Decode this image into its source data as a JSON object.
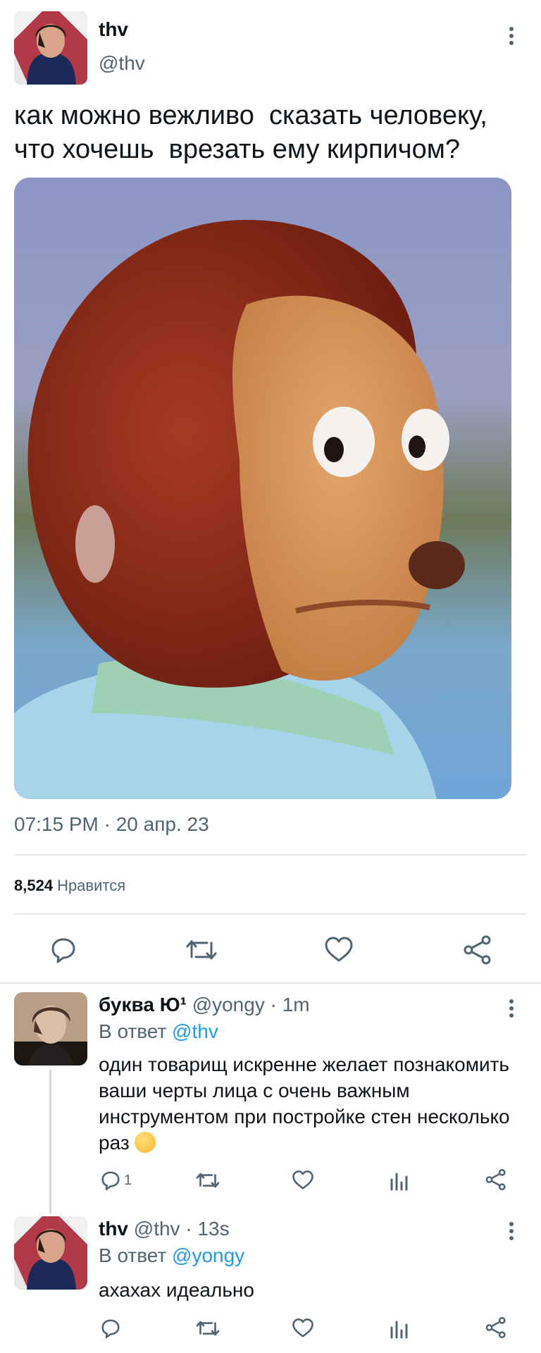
{
  "tweet": {
    "author_name": "thv",
    "author_handle": "@thv",
    "text": "как можно вежливо  сказать человеку,\nчто хочешь  врезать ему кирпичом?",
    "timestamp": "07:15 PM · 20 апр. 23",
    "likes_count": "8,524",
    "likes_label": "Нравится",
    "actions": [
      "reply-icon",
      "retweet-icon",
      "like-icon",
      "share-icon"
    ]
  },
  "replies": [
    {
      "name": "буква Ю¹",
      "meta": "@yongy · 1m",
      "reply_prefix": "В ответ",
      "reply_to": "@thv",
      "text": "один товарищ  искренне желает познакомить ваши черты лица с очень важным инструментом при постройке стен несколько раз",
      "reply_count": "1",
      "emoji": "smirking-hand-over-mouth-emoji"
    },
    {
      "name": "thv",
      "meta": "@thv · 13s",
      "reply_prefix": "В ответ",
      "reply_to": "@yongy",
      "text": "ахахах идеально",
      "reply_count": ""
    }
  ],
  "colors": {
    "accent": "#1d9bf0",
    "secondary_text": "#536471",
    "primary_text": "#0f1419",
    "divider": "#e6e9eb"
  }
}
